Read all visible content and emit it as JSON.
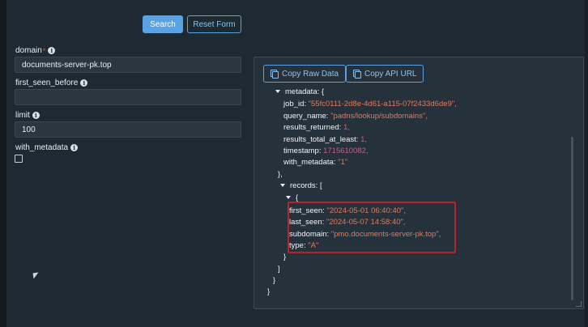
{
  "toolbar": {
    "search_label": "Search",
    "reset_label": "Reset Form"
  },
  "form": {
    "domain": {
      "label": "domain",
      "required_mark": "*",
      "value": "documents-server-pk.top"
    },
    "first_seen_before": {
      "label": "first_seen_before",
      "value": ""
    },
    "limit": {
      "label": "limit",
      "value": "100"
    },
    "with_metadata": {
      "label": "with_metadata",
      "checked": false
    }
  },
  "panel": {
    "copy_raw_label": "Copy Raw Data",
    "copy_api_label": "Copy API URL",
    "json": {
      "metadata_key": "metadata: {",
      "job_id": {
        "key": "job_id:",
        "value": "\"55fc0111-2d8e-4d61-a115-07f2433d6de9\","
      },
      "query_name": {
        "key": "query_name:",
        "value": "\"padns/lookup/subdomains\","
      },
      "results_returned": {
        "key": "results_returned:",
        "value": "1,"
      },
      "results_total_at_least": {
        "key": "results_total_at_least:",
        "value": "1,"
      },
      "timestamp": {
        "key": "timestamp:",
        "value": "1715610082,"
      },
      "with_metadata": {
        "key": "with_metadata:",
        "value": "\"1\""
      },
      "metadata_close": "},",
      "records_key": "records: [",
      "record_open": "{",
      "first_seen": {
        "key": "first_seen:",
        "value": "\"2024-05-01 06:40:40\","
      },
      "last_seen": {
        "key": "last_seen:",
        "value": "\"2024-05-07 14:58:40\","
      },
      "subdomain": {
        "key": "subdomain:",
        "value": "\"pmo.documents-server-pk.top\","
      },
      "type": {
        "key": "type:",
        "value": "\"A\""
      },
      "record_close": "}",
      "records_close": "]",
      "root_close_inner": "}",
      "root_close_outer": "}"
    }
  },
  "colors": {
    "accent": "#5aa2e6",
    "highlight_border": "#b8232a",
    "string_value": "#e27a5c",
    "number_value": "#c65c8c"
  }
}
